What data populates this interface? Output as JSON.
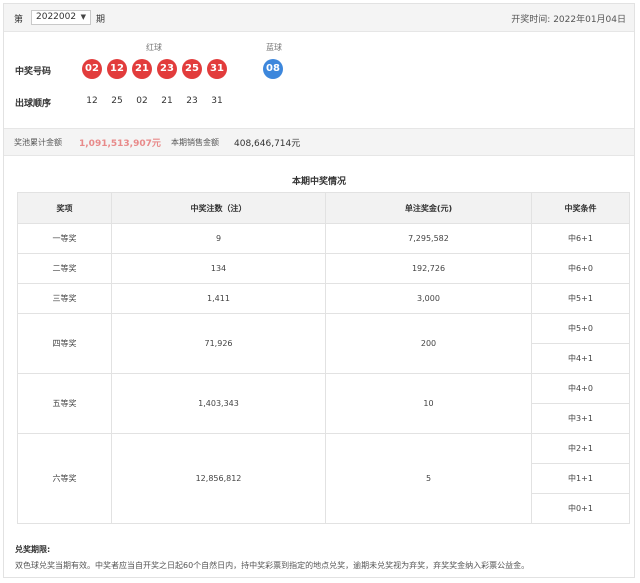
{
  "header": {
    "issue_prefix": "第",
    "issue_value": "2022002",
    "issue_suffix": "期",
    "draw_time_label": "开奖时间:",
    "draw_time_value": "2022年01月04日"
  },
  "balls": {
    "red_label": "红球",
    "blue_label": "蓝球",
    "winning_label": "中奖号码",
    "red": [
      "02",
      "12",
      "21",
      "23",
      "25",
      "31"
    ],
    "blue": [
      "08"
    ],
    "order_label": "出球顺序",
    "order": [
      "12",
      "25",
      "02",
      "21",
      "23",
      "31"
    ],
    "colors": {
      "red": "#e23c3c",
      "blue": "#3d87dc"
    }
  },
  "pool": {
    "pool_label": "奖池累计金额",
    "pool_value": "1,091,513,907元",
    "sales_label": "本期销售金额",
    "sales_value": "408,646,714元"
  },
  "prize": {
    "title": "本期中奖情况",
    "headers": [
      "奖项",
      "中奖注数（注）",
      "单注奖金(元)",
      "中奖条件"
    ],
    "levels": [
      {
        "name": "一等奖",
        "count": "9",
        "amount": "7,295,582",
        "conditions": [
          "中6+1"
        ]
      },
      {
        "name": "二等奖",
        "count": "134",
        "amount": "192,726",
        "conditions": [
          "中6+0"
        ]
      },
      {
        "name": "三等奖",
        "count": "1,411",
        "amount": "3,000",
        "conditions": [
          "中5+1"
        ]
      },
      {
        "name": "四等奖",
        "count": "71,926",
        "amount": "200",
        "conditions": [
          "中5+0",
          "中4+1"
        ]
      },
      {
        "name": "五等奖",
        "count": "1,403,343",
        "amount": "10",
        "conditions": [
          "中4+0",
          "中3+1"
        ]
      },
      {
        "name": "六等奖",
        "count": "12,856,812",
        "amount": "5",
        "conditions": [
          "中2+1",
          "中1+1",
          "中0+1"
        ]
      }
    ]
  },
  "rules": {
    "title": "兑奖期限:",
    "text": "双色球兑奖当期有效。中奖者应当自开奖之日起60个自然日内，持中奖彩票到指定的地点兑奖，逾期未兑奖视为弃奖，弃奖奖金纳入彩票公益金。"
  }
}
